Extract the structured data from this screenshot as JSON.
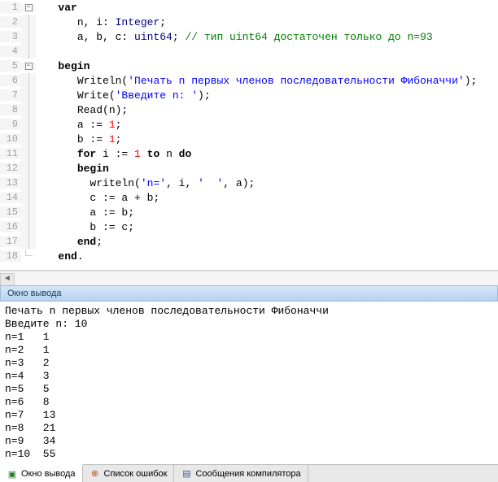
{
  "code": {
    "lines": [
      {
        "n": "1",
        "fold": "box",
        "indent": "   ",
        "tokens": [
          {
            "t": "var",
            "c": "kw"
          }
        ]
      },
      {
        "n": "2",
        "fold": "line",
        "indent": "      ",
        "tokens": [
          {
            "t": "n, i: "
          },
          {
            "t": "Integer",
            "c": "ty"
          },
          {
            "t": ";"
          }
        ]
      },
      {
        "n": "3",
        "fold": "line",
        "indent": "      ",
        "tokens": [
          {
            "t": "a, b, c: "
          },
          {
            "t": "uint64",
            "c": "ty"
          },
          {
            "t": "; "
          },
          {
            "t": "// тип uint64 достаточен только до n=93",
            "c": "cmt"
          }
        ]
      },
      {
        "n": "4",
        "fold": "line",
        "indent": "",
        "tokens": []
      },
      {
        "n": "5",
        "fold": "box",
        "indent": "   ",
        "tokens": [
          {
            "t": "begin",
            "c": "kw"
          }
        ]
      },
      {
        "n": "6",
        "fold": "line",
        "indent": "      ",
        "tokens": [
          {
            "t": "Writeln("
          },
          {
            "t": "'Печать n первых членов последовательности Фибоначчи'",
            "c": "str"
          },
          {
            "t": ");"
          }
        ]
      },
      {
        "n": "7",
        "fold": "line",
        "indent": "      ",
        "tokens": [
          {
            "t": "Write("
          },
          {
            "t": "'Введите n: '",
            "c": "str"
          },
          {
            "t": ");"
          }
        ]
      },
      {
        "n": "8",
        "fold": "line",
        "indent": "      ",
        "tokens": [
          {
            "t": "Read(n);"
          }
        ]
      },
      {
        "n": "9",
        "fold": "line",
        "indent": "      ",
        "tokens": [
          {
            "t": "a := "
          },
          {
            "t": "1",
            "c": "num"
          },
          {
            "t": ";"
          }
        ]
      },
      {
        "n": "10",
        "fold": "line",
        "indent": "      ",
        "tokens": [
          {
            "t": "b := "
          },
          {
            "t": "1",
            "c": "num"
          },
          {
            "t": ";"
          }
        ]
      },
      {
        "n": "11",
        "fold": "line",
        "indent": "      ",
        "tokens": [
          {
            "t": "for",
            "c": "kw"
          },
          {
            "t": " i := "
          },
          {
            "t": "1",
            "c": "num"
          },
          {
            "t": " "
          },
          {
            "t": "to",
            "c": "kw"
          },
          {
            "t": " n "
          },
          {
            "t": "do",
            "c": "kw"
          }
        ]
      },
      {
        "n": "12",
        "fold": "line",
        "indent": "      ",
        "tokens": [
          {
            "t": "begin",
            "c": "kw"
          }
        ]
      },
      {
        "n": "13",
        "fold": "line",
        "indent": "        ",
        "tokens": [
          {
            "t": "writeln("
          },
          {
            "t": "'n='",
            "c": "str"
          },
          {
            "t": ", i, "
          },
          {
            "t": "'  '",
            "c": "str"
          },
          {
            "t": ", a);"
          }
        ]
      },
      {
        "n": "14",
        "fold": "line",
        "indent": "        ",
        "tokens": [
          {
            "t": "c := a + b;"
          }
        ]
      },
      {
        "n": "15",
        "fold": "line",
        "indent": "        ",
        "tokens": [
          {
            "t": "a := b;"
          }
        ]
      },
      {
        "n": "16",
        "fold": "line",
        "indent": "        ",
        "tokens": [
          {
            "t": "b := c;"
          }
        ]
      },
      {
        "n": "17",
        "fold": "line",
        "indent": "      ",
        "tokens": [
          {
            "t": "end",
            "c": "kw"
          },
          {
            "t": ";"
          }
        ]
      },
      {
        "n": "18",
        "fold": "end",
        "indent": "   ",
        "tokens": [
          {
            "t": "end",
            "c": "kw"
          },
          {
            "t": "."
          }
        ]
      }
    ]
  },
  "output": {
    "title": "Окно вывода",
    "lines": [
      "Печать n первых членов последовательности Фибоначчи",
      "Введите n: 10",
      "n=1   1",
      "n=2   1",
      "n=3   2",
      "n=4   3",
      "n=5   5",
      "n=6   8",
      "n=7   13",
      "n=8   21",
      "n=9   34",
      "n=10  55"
    ]
  },
  "tabs": {
    "output": "Окно вывода",
    "errors": "Список ошибок",
    "compiler": "Сообщения компилятора"
  }
}
